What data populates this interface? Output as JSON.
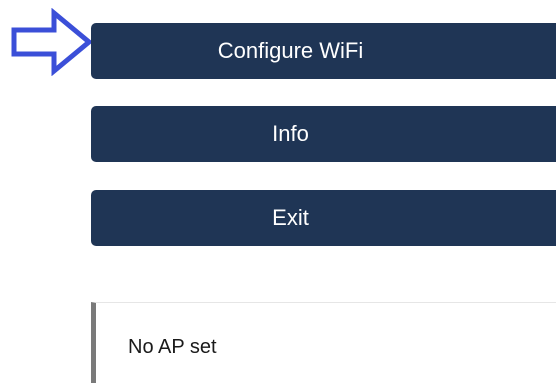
{
  "menu": {
    "configure_wifi_label": "Configure WiFi",
    "info_label": "Info",
    "exit_label": "Exit"
  },
  "status": {
    "message": "No AP set"
  },
  "pointer": {
    "icon": "right-arrow-outline-icon",
    "color": "#3b4fd8"
  },
  "colors": {
    "button_bg": "#1f3555",
    "button_text": "#ffffff",
    "status_border": "#7a7a7a"
  }
}
